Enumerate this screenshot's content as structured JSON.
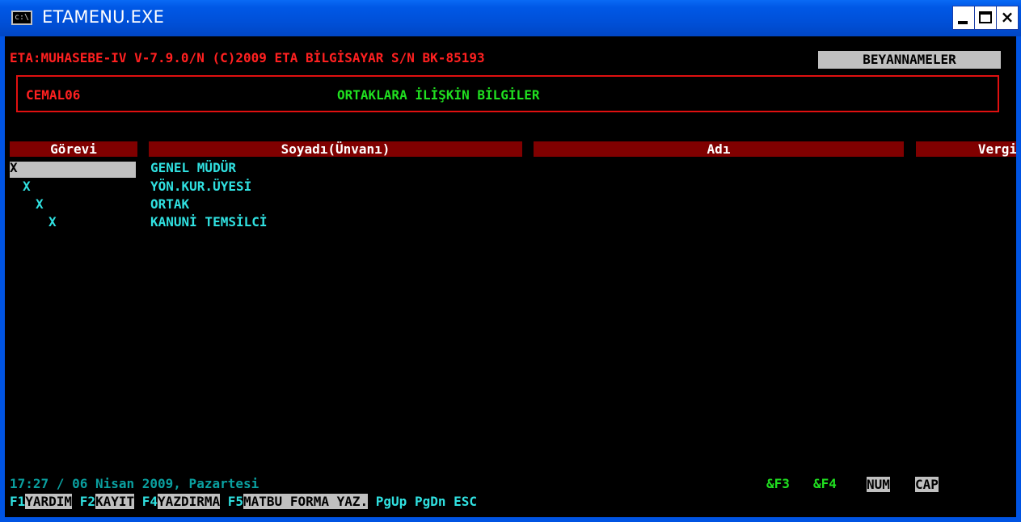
{
  "window": {
    "title": "ETAMENU.EXE",
    "icon": "console-icon",
    "icon_text": "c:\\",
    "close_glyph": "×"
  },
  "header": {
    "program": "ETA:MUHASEBE-IV V-7.9.0/N (C)2009 ETA BİLGİSAYAR S/N BK-85193",
    "section": "BEYANNAMELER",
    "company": "CEMAL06",
    "form_title": "ORTAKLARA İLİŞKİN BİLGİLER"
  },
  "columns": [
    "Görevi",
    "Soyadı(Ünvanı)",
    "Adı",
    "Vergi"
  ],
  "roles": [
    {
      "mark": "X",
      "label": "GENEL MÜDÜR",
      "selected": true
    },
    {
      "mark": "X",
      "label": "YÖN.KUR.ÜYESİ",
      "selected": false
    },
    {
      "mark": "X",
      "label": "ORTAK",
      "selected": false
    },
    {
      "mark": "X",
      "label": "KANUNİ TEMSİLCİ",
      "selected": false
    }
  ],
  "status": {
    "datetime": "17:27 / 06 Nisan 2009, Pazartesi",
    "hotkey1": "&F3",
    "hotkey2": "&F4",
    "num": "NUM",
    "cap": "CAP"
  },
  "fkeys": [
    {
      "key": "F1",
      "label": "YARDIM"
    },
    {
      "key": "F2",
      "label": "KAYIT"
    },
    {
      "key": "F4",
      "label": "YAZDIRMA"
    },
    {
      "key": "F5",
      "label": "MATBU FORMA YAZ."
    }
  ],
  "fkeys_tail": [
    "PgUp",
    "PgDn",
    "ESC"
  ],
  "colors": {
    "console_bg": "#000000",
    "red_text": "#ff2020",
    "green_text": "#20e020",
    "cyan_text": "#30e0e0",
    "column_header_bg": "#800000",
    "highlight_bg": "#c0c0c0",
    "titlebar_blue": "#0054e3"
  }
}
